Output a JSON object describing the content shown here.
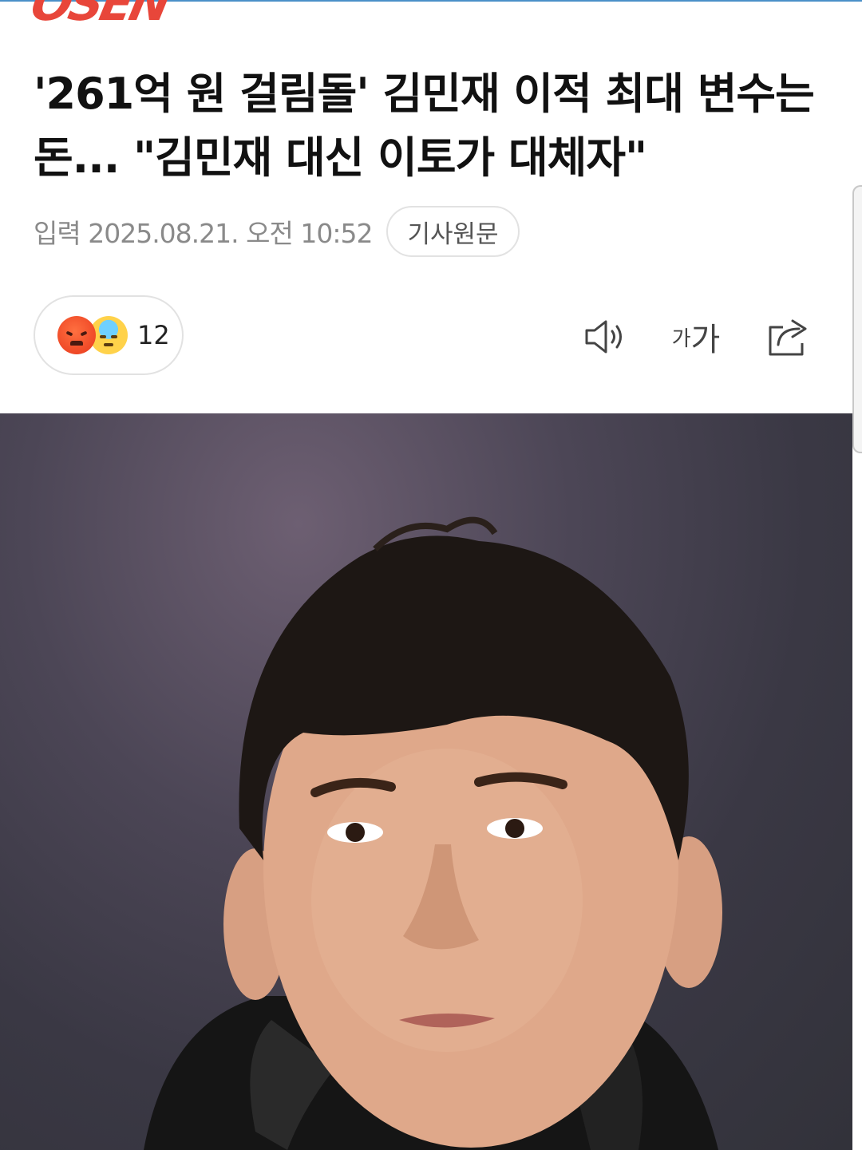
{
  "brand": {
    "logo_text": "OSEN",
    "accent": "#e8463a"
  },
  "article": {
    "headline": "'261억 원 걸림돌' 김민재 이적 최대 변수는 돈... \"김민재 대신 이토가 대체자\"",
    "date": "입력 2025.08.21. 오전 10:52",
    "origin_label": "기사원문"
  },
  "reactions": {
    "icons": [
      "angry-emoji-icon",
      "sad-sweat-emoji-icon"
    ],
    "count": "12"
  },
  "toolbar": {
    "font_small": "가",
    "font_large": "가",
    "icons": [
      "speaker-icon",
      "font-size-icon",
      "share-icon"
    ]
  },
  "photo": {
    "subject": "photo-of-player"
  }
}
